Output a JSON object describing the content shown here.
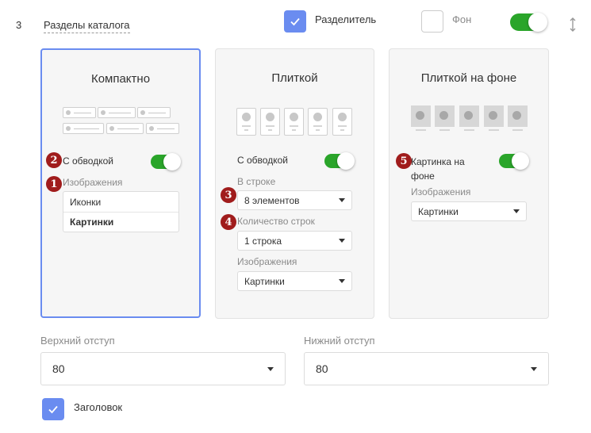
{
  "header": {
    "section_number": "3",
    "section_title": "Разделы каталога",
    "divider_label": "Разделитель",
    "divider_checked": true,
    "background_label": "Фон",
    "background_checked": false,
    "enabled": true
  },
  "cards": {
    "compact": {
      "title": "Компактно",
      "selected": true,
      "border_label": "С обводкой",
      "border_on": true,
      "images_label": "Изображения",
      "options": [
        "Иконки",
        "Картинки"
      ],
      "selected_option": "Картинки"
    },
    "tile": {
      "title": "Плиткой",
      "border_label": "С обводкой",
      "border_on": true,
      "per_row_label": "В строке",
      "per_row_value": "8 элементов",
      "rows_label": "Количество строк",
      "rows_value": "1 строка",
      "images_label": "Изображения",
      "images_value": "Картинки"
    },
    "tile_bg": {
      "title": "Плиткой на фоне",
      "bg_image_label": "Картинка на фоне",
      "bg_image_on": true,
      "images_label": "Изображения",
      "images_value": "Картинки"
    }
  },
  "markers": [
    "1",
    "2",
    "3",
    "4",
    "5"
  ],
  "margins": {
    "top_label": "Верхний отступ",
    "top_value": "80",
    "bottom_label": "Нижний отступ",
    "bottom_value": "80"
  },
  "heading": {
    "label": "Заголовок",
    "checked": true
  },
  "colors": {
    "accent": "#6a8cf0",
    "toggle_on": "#2aa52a",
    "marker": "#a01c1c"
  }
}
